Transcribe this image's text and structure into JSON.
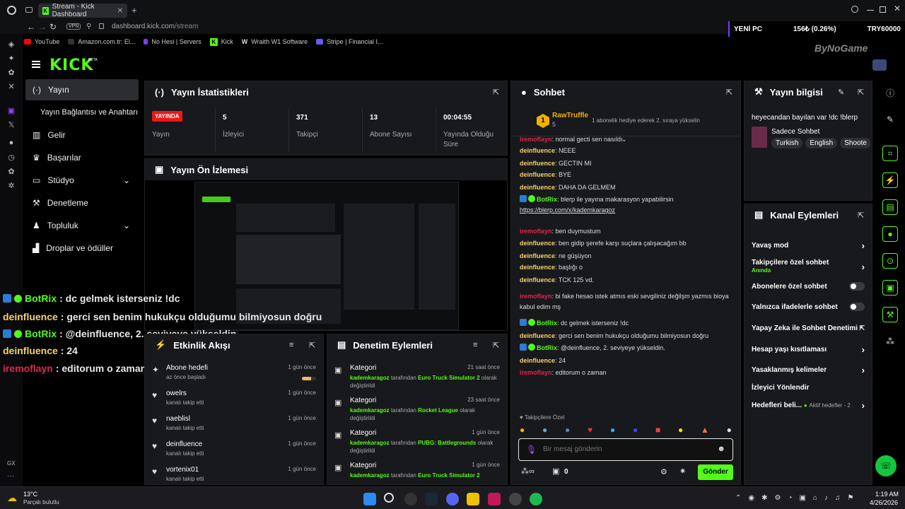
{
  "browser": {
    "tab_title": "Stream - Kick Dashboard",
    "url_host": "dashboard.kick.com",
    "url_path": "/stream",
    "vpn_label": "VPN",
    "gx_label": "GX",
    "bookmarks": [
      "YouTube",
      "Amazon.com.tr: El...",
      "No Hesi | Servers",
      "Kick",
      "Wraith W1 Software",
      "Stripe | Financial I..."
    ]
  },
  "ticker": {
    "name": "YENİ PC",
    "change": "156₺ (0.26%)",
    "goal": "TRY60000"
  },
  "overlay_brand": "ByNoGame",
  "brand": {
    "logo": "KICK",
    "beta": "BETA"
  },
  "nav": {
    "items": [
      {
        "label": "Yayın"
      },
      {
        "label": "Yayın Bağlantısı ve Anahtarı"
      },
      {
        "label": "Gelir"
      },
      {
        "label": "Başarılar"
      },
      {
        "label": "Stüdyo"
      },
      {
        "label": "Denetleme"
      },
      {
        "label": "Topluluk"
      },
      {
        "label": "Droplar ve ödüller"
      }
    ]
  },
  "stats": {
    "title": "Yayın İstatistikleri",
    "live_badge": "YAYINDA",
    "items": [
      {
        "value": "",
        "label": "Yayın"
      },
      {
        "value": "5",
        "label": "İzleyici"
      },
      {
        "value": "371",
        "label": "Takipçi"
      },
      {
        "value": "13",
        "label": "Abone Sayısı"
      },
      {
        "value": "00:04:55",
        "label": "Yayında Olduğu Süre"
      }
    ]
  },
  "preview": {
    "title": "Yayın Ön İzlemesi"
  },
  "overlay_chat": [
    {
      "user": "BotRix",
      "text": ": dc gelmek isterseniz !dc",
      "type": "bot"
    },
    {
      "user": "deinfluence",
      "text": ": gerci sen benim hukukçu olduğumu bilmiyosun doğru",
      "type": "deinf"
    },
    {
      "user": "BotRix",
      "text": ": @deinfluence, 2. seviyeye yükseldin.",
      "type": "bot"
    },
    {
      "user": "deinfluence",
      "text": ": 24",
      "type": "deinf"
    },
    {
      "user": "iremoflayn",
      "text": ": editorum o zaman",
      "type": "ire"
    }
  ],
  "activity": {
    "title": "Etkinlik Akışı",
    "items": [
      {
        "title": "Abone hedefi",
        "sub": "az önce başladı",
        "time": "1 gün önce"
      },
      {
        "title": "owelrs",
        "sub": "kanalı takip etti",
        "time": "1 gün önce"
      },
      {
        "title": "naeblisl",
        "sub": "kanalı takip etti",
        "time": "1 gün önce"
      },
      {
        "title": "deinfluence",
        "sub": "kanalı takip etti",
        "time": "1 gün önce"
      },
      {
        "title": "vortenix01",
        "sub": "kanalı takip etti",
        "time": "1 gün önce"
      }
    ],
    "goal_progress": 0.65
  },
  "moderation": {
    "title": "Denetim Eylemleri",
    "items": [
      {
        "title": "Kategori",
        "user": "kademkaragoz",
        "mid": "tarafından",
        "game": "Euro Truck Simulator 2",
        "end": "olarak değiştirildi",
        "time": "21 saat önce"
      },
      {
        "title": "Kategori",
        "user": "kademkaragoz",
        "mid": "tarafından",
        "game": "Rocket League",
        "end": "olarak değiştirildi",
        "time": "23 saat önce"
      },
      {
        "title": "Kategori",
        "user": "kademkaragoz",
        "mid": "tarafından",
        "game": "PUBG: Battlegrounds",
        "end": "olarak değiştirildi",
        "time": "1 gün önce"
      },
      {
        "title": "Kategori",
        "user": "kademkaragoz",
        "mid": "tarafından",
        "game": "Euro Truck Simulator 2",
        "end": "",
        "time": "1 gün önce"
      }
    ]
  },
  "chat": {
    "title": "Sohbet",
    "pinned_user": "RawTruffle",
    "pinned_rank": "1",
    "pinned_count": "5",
    "pinned_text": "1 abonelik hediye ederek 2. sıraya yükselin",
    "messages": [
      {
        "user": "iremoflayn",
        "text": ": normal gecti sen nasıldı",
        "type": "ire"
      },
      {
        "user": "deinfluence",
        "text": ": NEEE",
        "type": "deinf"
      },
      {
        "user": "deinfluence",
        "text": ": GECTIN MI",
        "type": "deinf"
      },
      {
        "user": "deinfluence",
        "text": ": BYE",
        "type": "deinf"
      },
      {
        "user": "deinfluence",
        "text": ": DAHA DA GELMEM",
        "type": "deinf"
      },
      {
        "user": "BotRix",
        "text": ": blerp ile yayına makarasyon yapabilirsin",
        "link": "https://blerp.com/x/kademkaragoz",
        "type": "bot"
      },
      {
        "user": "iremoflayn",
        "text": ": ben duymustum",
        "type": "ire"
      },
      {
        "user": "deinfluence",
        "text": ": ben gidip şerefe karşı suçlara çalışacağım bb",
        "type": "deinf"
      },
      {
        "user": "deinfluence",
        "text": ": ne güşüyon",
        "type": "deinf"
      },
      {
        "user": "deinfluence",
        "text": ": başlığı o",
        "type": "deinf"
      },
      {
        "user": "deinfluence",
        "text": ": TCK 125 vd.",
        "type": "deinf"
      },
      {
        "user": "iremoflayn",
        "text": ": bi fake hesao istek atmıs eski sevgiliniz değilşm yazmıs bioya kabul edim mş",
        "type": "ire"
      },
      {
        "user": "BotRix",
        "text": ": dc gelmek isterseniz !dc",
        "type": "bot"
      },
      {
        "user": "deinfluence",
        "text": ": gerci sen benim hukukçu olduğumu bilmiyosun doğru",
        "type": "deinf"
      },
      {
        "user": "BotRix",
        "text": ": @deinfluence, 2. seviyeye yükseldin.",
        "type": "bot"
      },
      {
        "user": "deinfluence",
        "text": ": 24",
        "type": "deinf"
      },
      {
        "user": "iremoflayn",
        "text": ": editorum o zaman",
        "type": "ire"
      }
    ],
    "follower_only": "Takipçilere Özel",
    "placeholder": "Bir mesaj gönderin",
    "points": "0",
    "send": "Gönder"
  },
  "stream_info": {
    "title": "Yayın bilgisi",
    "stream_title": "heyecandan bayılan var !dc !blerp",
    "category": "Sadece Sohbet",
    "tags": [
      "Turkish",
      "English",
      "Shoote"
    ]
  },
  "channel_actions": {
    "title": "Kanal Eylemleri",
    "items": [
      {
        "label": "Yavaş mod",
        "control": "chevron"
      },
      {
        "label": "Takipçilere özel sohbet",
        "sub": "Anında",
        "control": "chevron"
      },
      {
        "label": "Abonelere özel sohbet",
        "control": "toggle"
      },
      {
        "label": "Yalnızca ifadelerle sohbet",
        "control": "toggle"
      },
      {
        "label": "Yapay Zeka ile Sohbet Denetimi",
        "control": "external"
      },
      {
        "label": "Hesap yaşı kısıtlaması",
        "control": "chevron"
      },
      {
        "label": "Yasaklanmış kelimeler",
        "control": "chevron"
      },
      {
        "label": "İzleyici Yönlendir",
        "control": "none"
      },
      {
        "label": "Hedefleri beli...",
        "sub": "Aktif hedefler - 2",
        "control": "chevron"
      }
    ]
  },
  "taskbar": {
    "weather_temp": "13°C",
    "weather_desc": "Parçalı bulutlu",
    "time": "1:19 AM",
    "date": "4/26/2026"
  },
  "colors": {
    "accent": "#53fc18",
    "live": "#e91916",
    "panel": "#18191c",
    "deinfluence": "#f4d26b",
    "iremoflayn": "#e02450",
    "botrix": "#53fc18"
  }
}
